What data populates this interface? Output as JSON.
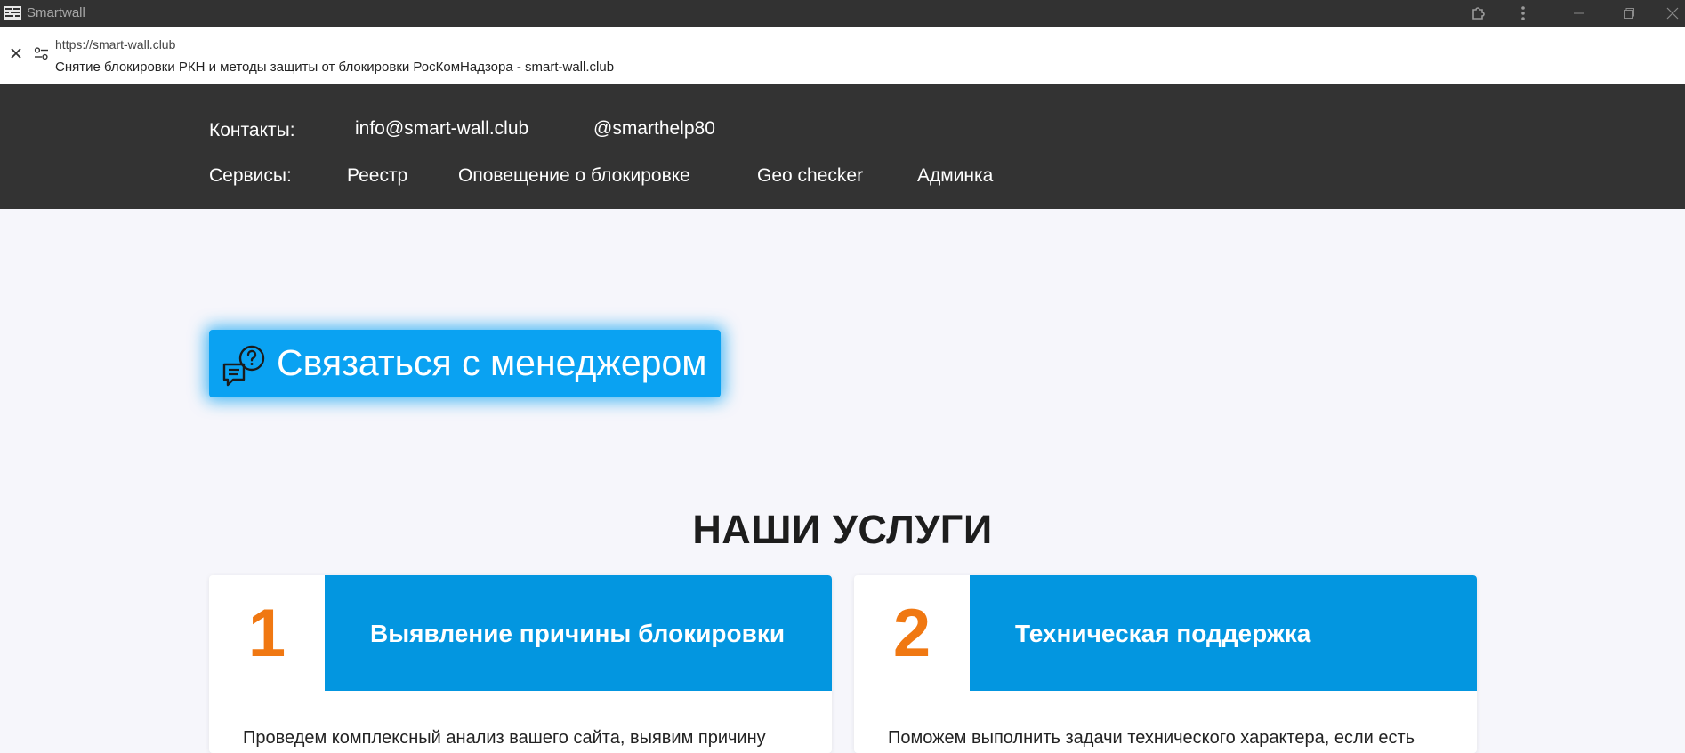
{
  "window": {
    "title": "Smartwall"
  },
  "urlbar": {
    "url": "https://smart-wall.club",
    "page_title": "Снятие блокировки РКН и методы защиты от блокировки РосКомНадзора - smart-wall.club"
  },
  "header": {
    "contacts_label": "Контакты:",
    "email": "info@smart-wall.club",
    "telegram": "@smarthelp80",
    "services_label": "Сервисы:",
    "services": [
      "Реестр",
      "Оповещение о блокировке",
      "Geo checker",
      "Админка"
    ]
  },
  "cta": {
    "label": "Связаться с менеджером"
  },
  "services_section": {
    "title": "НАШИ УСЛУГИ",
    "cards": [
      {
        "number": "1",
        "title": "Выявление причины блокировки",
        "description": "Проведем комплексный анализ вашего сайта, выявим причину"
      },
      {
        "number": "2",
        "title": "Техническая поддержка",
        "description": "Поможем выполнить задачи технического характера, если есть"
      }
    ]
  },
  "colors": {
    "header_bg": "#333333",
    "accent_blue": "#0396e0",
    "cta_blue": "#0aa2f2",
    "number_orange": "#f07812",
    "page_bg": "#f6f6fb"
  }
}
